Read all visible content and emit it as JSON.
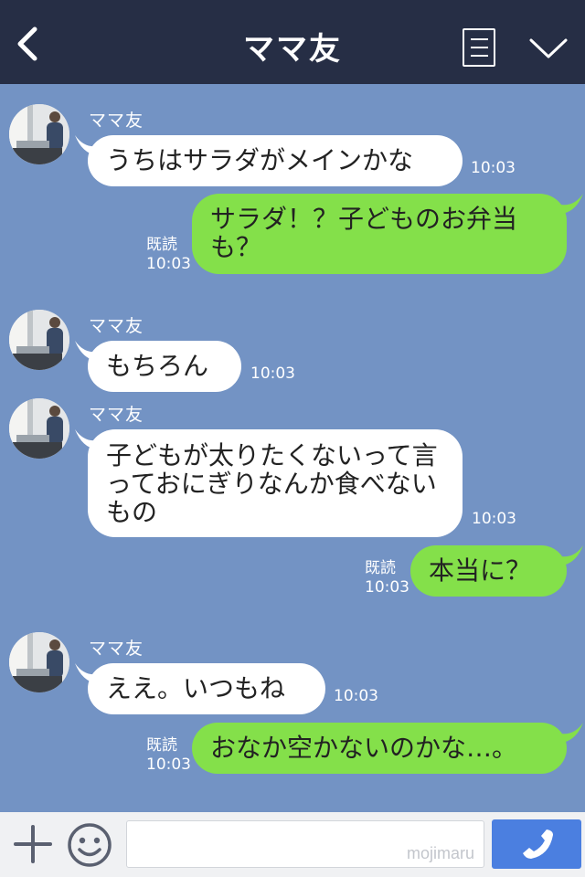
{
  "header": {
    "title": "ママ友",
    "back_icon": "chevron-left-icon",
    "menu_icon": "menu-icon",
    "collapse_icon": "chevron-down-icon"
  },
  "messages": [
    {
      "sender": "ママ友",
      "text": "うちはサラダがメインかな",
      "time": "10:03"
    },
    {
      "text": "サラダ！？子どものお弁当も？",
      "read": "既読",
      "time": "10:03"
    },
    {
      "sender": "ママ友",
      "text": "もちろん",
      "time": "10:03"
    },
    {
      "sender": "ママ友",
      "text": "子どもが太りたくないって言っておにぎりなんか食べないもの",
      "time": "10:03"
    },
    {
      "text": "本当に？",
      "read": "既読",
      "time": "10:03"
    },
    {
      "sender": "ママ友",
      "text": "ええ。いつもね",
      "time": "10:03"
    },
    {
      "text": "おなか空かないのかな…。",
      "read": "既読",
      "time": "10:03"
    }
  ],
  "footer": {
    "watermark": "mojimaru",
    "plus_icon": "plus-icon",
    "emoji_icon": "smiley-icon",
    "call_icon": "phone-icon"
  },
  "colors": {
    "header_bg": "#262e45",
    "chat_bg": "#7393c4",
    "incoming_bubble": "#ffffff",
    "outgoing_bubble": "#84e04a",
    "call_button": "#4b7fe0"
  }
}
